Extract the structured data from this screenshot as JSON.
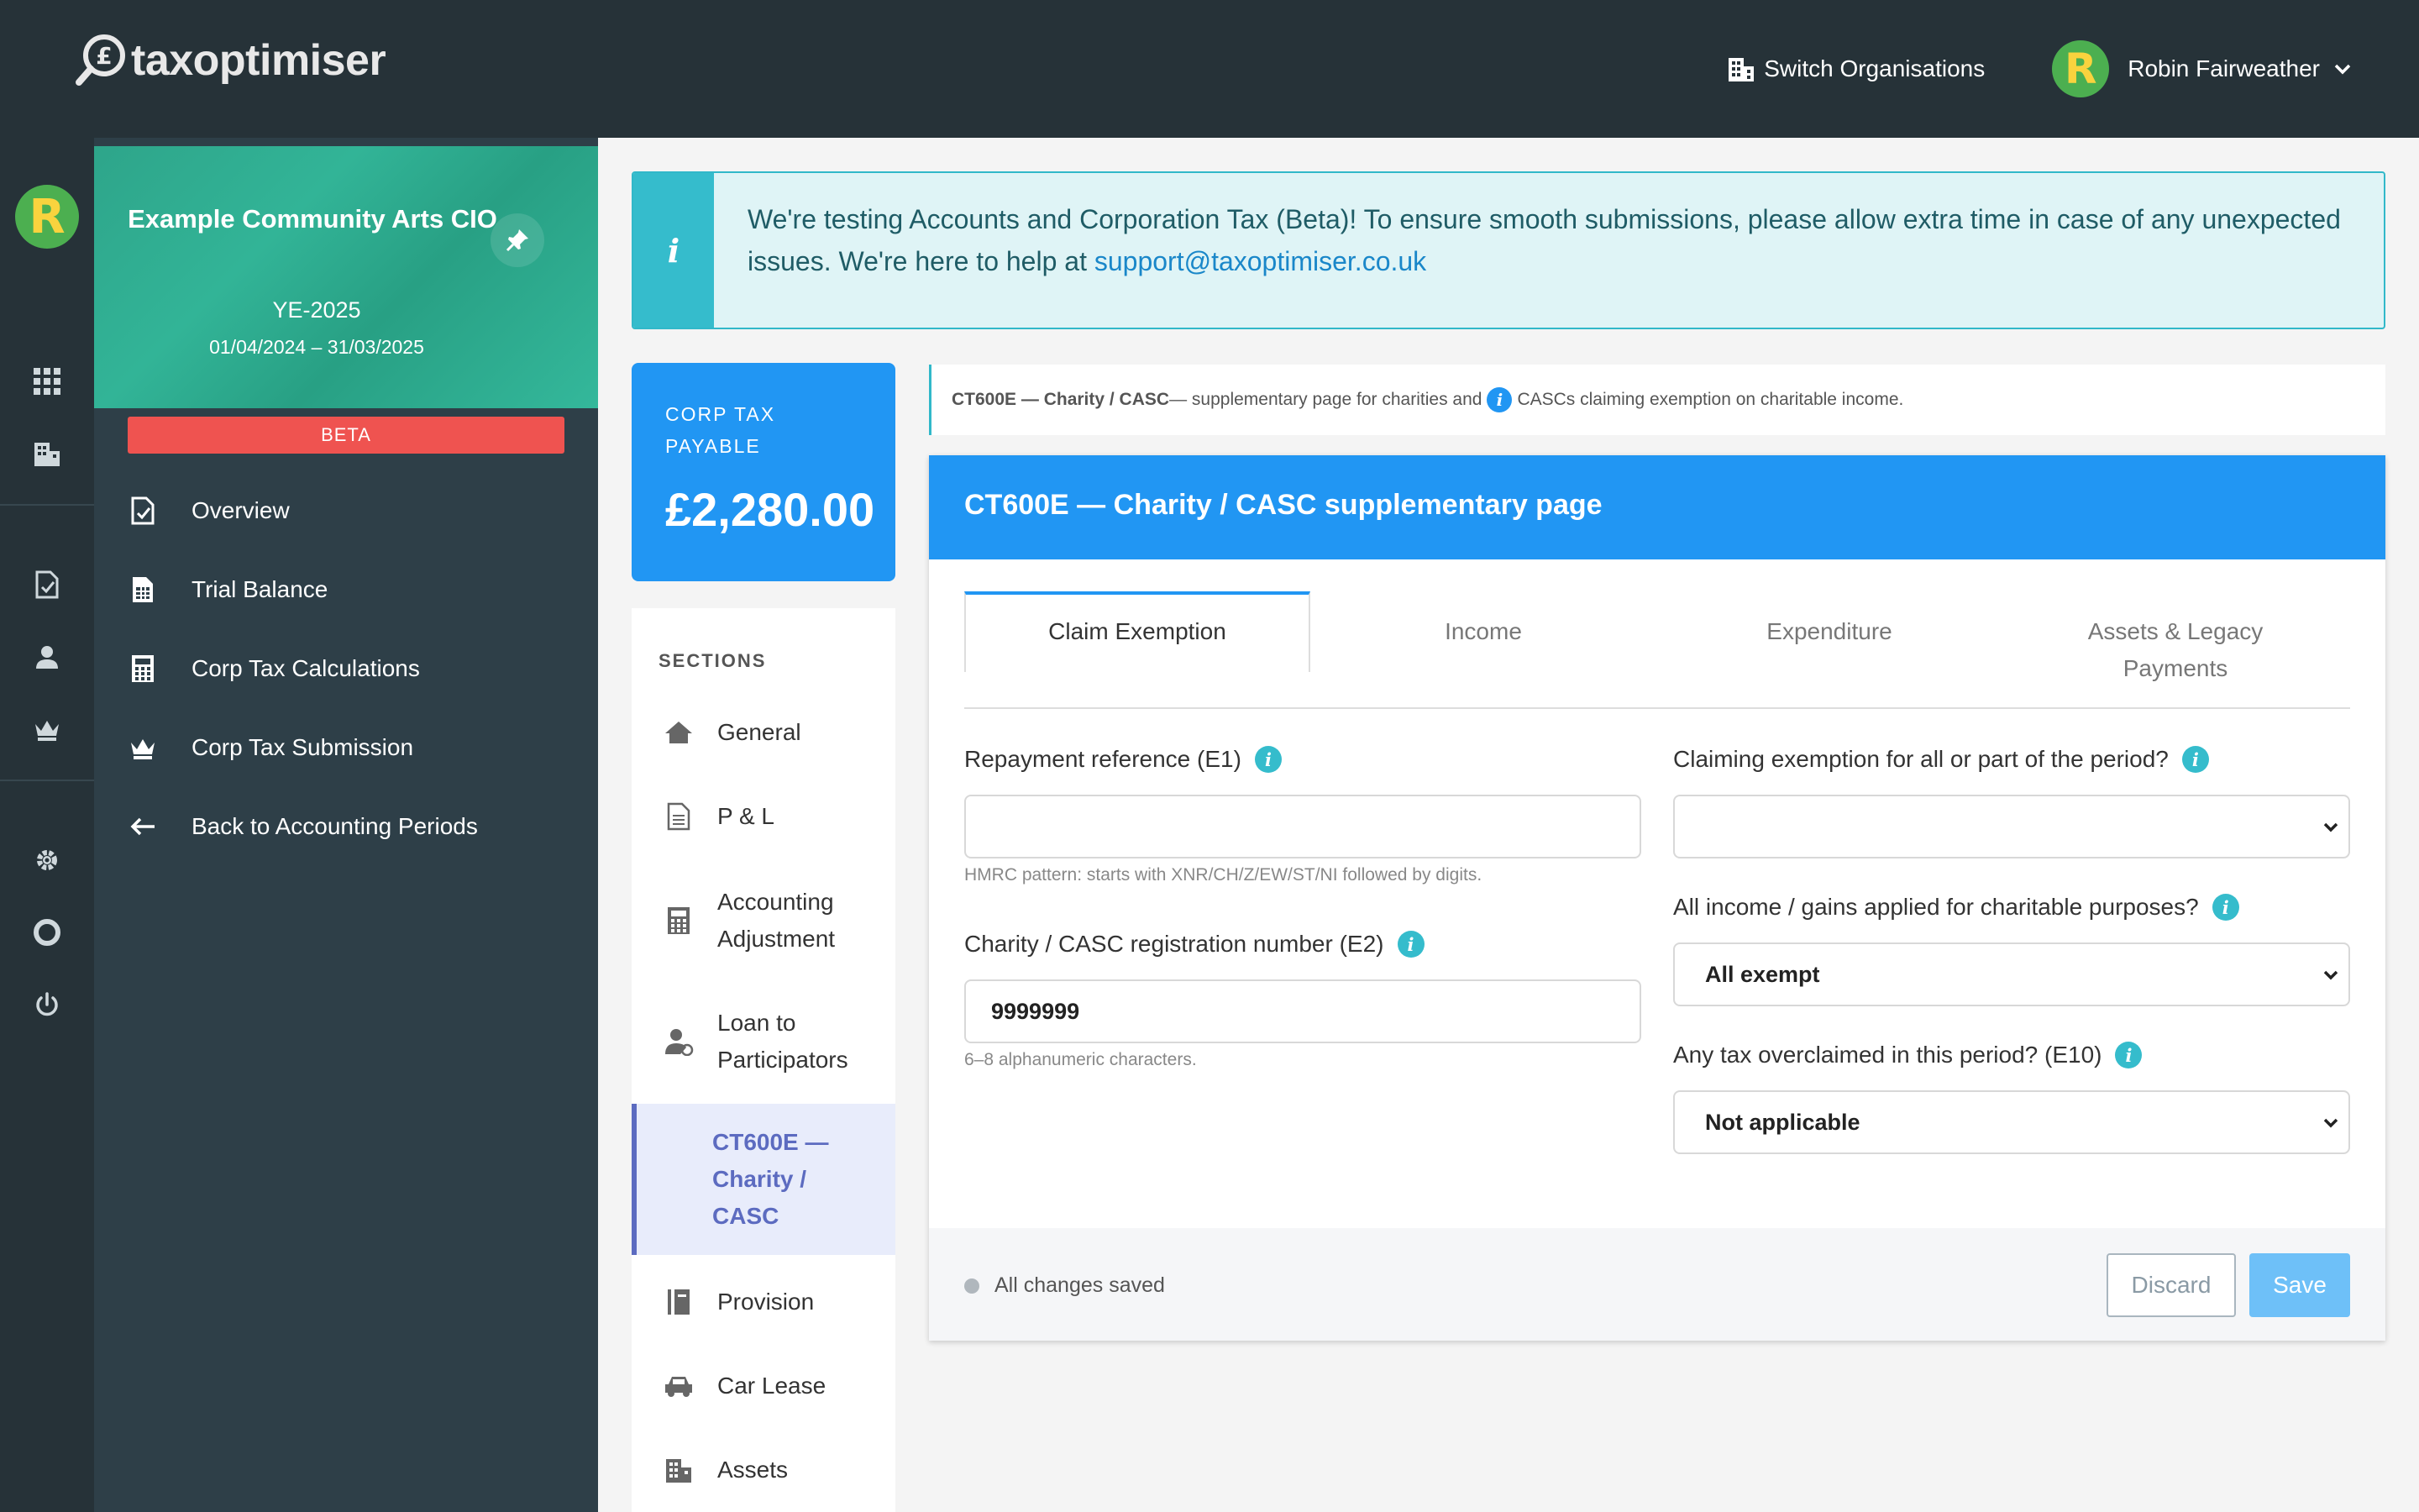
{
  "app": {
    "logo_text": "taxoptimiser",
    "logo_symbol": "£"
  },
  "header": {
    "switch_org": "Switch Organisations",
    "user_name": "Robin Fairweather",
    "user_initial": "R"
  },
  "org": {
    "initial": "R",
    "name": "Example Community Arts CIO",
    "period": "YE-2025",
    "dates": "01/04/2024 – 31/03/2025",
    "badge": "BETA"
  },
  "nav": [
    {
      "label": "Overview",
      "icon": "document-check-icon"
    },
    {
      "label": "Trial Balance",
      "icon": "spreadsheet-icon"
    },
    {
      "label": "Corp Tax Calculations",
      "icon": "calculator-icon"
    },
    {
      "label": "Corp Tax Submission",
      "icon": "crown-icon"
    },
    {
      "label": "Back to Accounting Periods",
      "icon": "arrow-left-icon"
    }
  ],
  "banner": {
    "text": "We're testing Accounts and Corporation Tax (Beta)! To ensure smooth submissions, please allow extra time in case of any unexpected issues. We're here to help at ",
    "link": "support@taxoptimiser.co.uk"
  },
  "corp_tax": {
    "label": "CORP TAX PAYABLE",
    "value": "£2,280.00"
  },
  "sections": {
    "heading": "SECTIONS",
    "items": [
      {
        "label": "General",
        "icon": "home-icon"
      },
      {
        "label": "P & L",
        "icon": "document-icon"
      },
      {
        "label": "Accounting Adjustment",
        "icon": "calculator-icon"
      },
      {
        "label": "Loan to Participators",
        "icon": "user-loan-icon"
      },
      {
        "label": "CT600E — Charity / CASC",
        "icon": "",
        "active": true
      },
      {
        "label": "Provision",
        "icon": "book-icon"
      },
      {
        "label": "Car Lease",
        "icon": "car-icon"
      },
      {
        "label": "Assets",
        "icon": "building-icon"
      }
    ]
  },
  "hint": {
    "bold": "CT600E — Charity / CASC",
    "text_a": " — supplementary page for charities and ",
    "text_b": "CASCs claiming exemption on charitable income."
  },
  "form": {
    "title": "CT600E — Charity / CASC supplementary page",
    "tabs": [
      "Claim Exemption",
      "Income",
      "Expenditure",
      "Assets & Legacy Payments"
    ],
    "e1_label": "Repayment reference (E1)",
    "e1_value": "",
    "e1_help": "HMRC pattern: starts with XNR/CH/Z/EW/ST/NI followed by digits.",
    "e2_label": "Charity / CASC registration number (E2)",
    "e2_value": "9999999",
    "e2_help": "6–8 alphanumeric characters.",
    "claim_label": "Claiming exemption for all or part of the period?",
    "claim_value": "",
    "income_label": "All income / gains applied for charitable purposes?",
    "income_value": "All exempt",
    "e10_label": "Any tax overclaimed in this period? (E10)",
    "e10_value": "Not applicable",
    "status": "All changes saved",
    "discard": "Discard",
    "save": "Save"
  },
  "colors": {
    "topbar": "#263238",
    "sidebar": "#2e3f48",
    "primary": "#2196f3",
    "info": "#35bccc",
    "beta": "#ef5350",
    "org_card": "#2ea58a"
  }
}
